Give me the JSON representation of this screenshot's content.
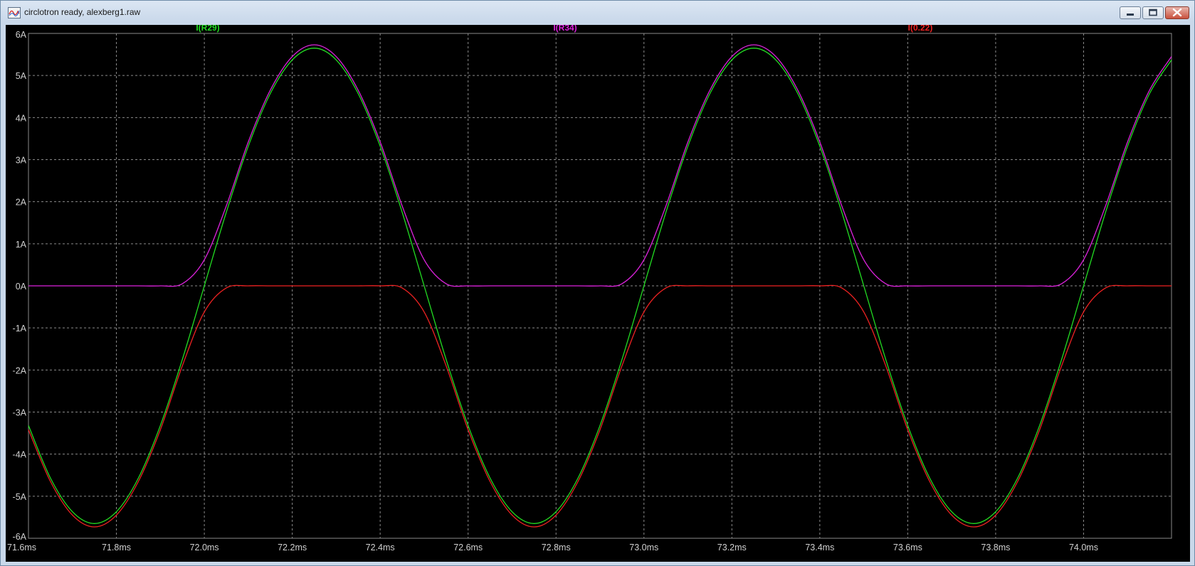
{
  "window": {
    "title": "circlotron ready, alexberg1.raw",
    "icon": "waveform-viewer-icon",
    "controls": [
      "minimize-icon",
      "maximize-icon",
      "close-icon"
    ]
  },
  "chart_data": {
    "type": "line",
    "xlabel": "",
    "ylabel": "",
    "xlim": [
      71.6,
      74.2
    ],
    "ylim": [
      -6,
      6
    ],
    "x_ticks": [
      "71.6ms",
      "71.8ms",
      "72.0ms",
      "72.2ms",
      "72.4ms",
      "72.6ms",
      "72.8ms",
      "73.0ms",
      "73.2ms",
      "73.4ms",
      "73.6ms",
      "73.8ms",
      "74.0ms"
    ],
    "x_tick_values": [
      71.6,
      71.8,
      72.0,
      72.2,
      72.4,
      72.6,
      72.8,
      73.0,
      73.2,
      73.4,
      73.6,
      73.8,
      74.0
    ],
    "y_ticks": [
      "6A",
      "5A",
      "4A",
      "3A",
      "2A",
      "1A",
      "0A",
      "-1A",
      "-2A",
      "-3A",
      "-4A",
      "-5A",
      "-6A"
    ],
    "y_tick_values": [
      6,
      5,
      4,
      3,
      2,
      1,
      0,
      -1,
      -2,
      -3,
      -4,
      -5,
      -6
    ],
    "grid": true,
    "background": "#000000",
    "grid_color": "#8a8a8a",
    "axis_text_color": "#d0d0d0",
    "series": [
      {
        "name": "I(R29)",
        "color": "#22dd22",
        "x": [
          71.6,
          71.65,
          71.7,
          71.75,
          71.8,
          71.85,
          71.9,
          71.95,
          72.0,
          72.05,
          72.1,
          72.15,
          72.2,
          72.25,
          72.3,
          72.35,
          72.4,
          72.45,
          72.5,
          72.55,
          72.6,
          72.65,
          72.7,
          72.75,
          72.8,
          72.85,
          72.9,
          72.95,
          73.0,
          73.05,
          73.1,
          73.15,
          73.2,
          73.25,
          73.3,
          73.35,
          73.4,
          73.45,
          73.5,
          73.55,
          73.6,
          73.65,
          73.7,
          73.75,
          73.8,
          73.85,
          73.9,
          73.95,
          74.0,
          74.05,
          74.1,
          74.15,
          74.2
        ],
        "values": [
          -3.32,
          -4.57,
          -5.37,
          -5.65,
          -5.37,
          -4.57,
          -3.32,
          -1.75,
          0,
          1.75,
          3.32,
          4.57,
          5.37,
          5.65,
          5.37,
          4.57,
          3.32,
          1.75,
          0,
          -1.75,
          -3.32,
          -4.57,
          -5.37,
          -5.65,
          -5.37,
          -4.57,
          -3.32,
          -1.75,
          0,
          1.75,
          3.32,
          4.57,
          5.37,
          5.65,
          5.37,
          4.57,
          3.32,
          1.75,
          0,
          -1.75,
          -3.32,
          -4.57,
          -5.37,
          -5.65,
          -5.37,
          -4.57,
          -3.32,
          -1.75,
          0,
          1.75,
          3.32,
          4.57,
          5.37
        ]
      },
      {
        "name": "I(R34)",
        "color": "#dd22dd",
        "x": [
          71.6,
          71.65,
          71.7,
          71.75,
          71.8,
          71.85,
          71.9,
          71.95,
          72.0,
          72.05,
          72.1,
          72.15,
          72.2,
          72.25,
          72.3,
          72.35,
          72.4,
          72.45,
          72.5,
          72.55,
          72.6,
          72.65,
          72.7,
          72.75,
          72.8,
          72.85,
          72.9,
          72.95,
          73.0,
          73.05,
          73.1,
          73.15,
          73.2,
          73.25,
          73.3,
          73.35,
          73.4,
          73.45,
          73.5,
          73.55,
          73.6,
          73.65,
          73.7,
          73.75,
          73.8,
          73.85,
          73.9,
          73.95,
          74.0,
          74.05,
          74.1,
          74.15,
          74.2
        ],
        "values": [
          0,
          0,
          0,
          0,
          0,
          0,
          0,
          0.05,
          0.62,
          1.9,
          3.42,
          4.65,
          5.45,
          5.73,
          5.45,
          4.65,
          3.42,
          1.9,
          0.62,
          0.05,
          0,
          0,
          0,
          0,
          0,
          0,
          0,
          0.05,
          0.62,
          1.9,
          3.42,
          4.65,
          5.45,
          5.73,
          5.45,
          4.65,
          3.42,
          1.9,
          0.62,
          0.05,
          0,
          0,
          0,
          0,
          0,
          0,
          0,
          0.05,
          0.62,
          1.9,
          3.42,
          4.65,
          5.45
        ]
      },
      {
        "name": "I(0.22)",
        "color": "#ee2222",
        "x": [
          71.6,
          71.65,
          71.7,
          71.75,
          71.8,
          71.85,
          71.9,
          71.95,
          72.0,
          72.05,
          72.1,
          72.15,
          72.2,
          72.25,
          72.3,
          72.35,
          72.4,
          72.45,
          72.5,
          72.55,
          72.6,
          72.65,
          72.7,
          72.75,
          72.8,
          72.85,
          72.9,
          72.95,
          73.0,
          73.05,
          73.1,
          73.15,
          73.2,
          73.25,
          73.3,
          73.35,
          73.4,
          73.45,
          73.5,
          73.55,
          73.6,
          73.65,
          73.7,
          73.75,
          73.8,
          73.85,
          73.9,
          73.95,
          74.0,
          74.05,
          74.1,
          74.15,
          74.2
        ],
        "values": [
          -3.42,
          -4.65,
          -5.45,
          -5.73,
          -5.45,
          -4.65,
          -3.42,
          -1.9,
          -0.62,
          -0.05,
          0,
          0,
          0,
          0,
          0,
          0,
          0,
          -0.05,
          -0.62,
          -1.9,
          -3.42,
          -4.65,
          -5.45,
          -5.73,
          -5.45,
          -4.65,
          -3.42,
          -1.9,
          -0.62,
          -0.05,
          0,
          0,
          0,
          0,
          0,
          0,
          0,
          -0.05,
          -0.62,
          -1.9,
          -3.42,
          -4.65,
          -5.45,
          -5.73,
          -5.45,
          -4.65,
          -3.42,
          -1.9,
          -0.62,
          -0.05,
          0,
          0,
          0
        ]
      }
    ]
  }
}
